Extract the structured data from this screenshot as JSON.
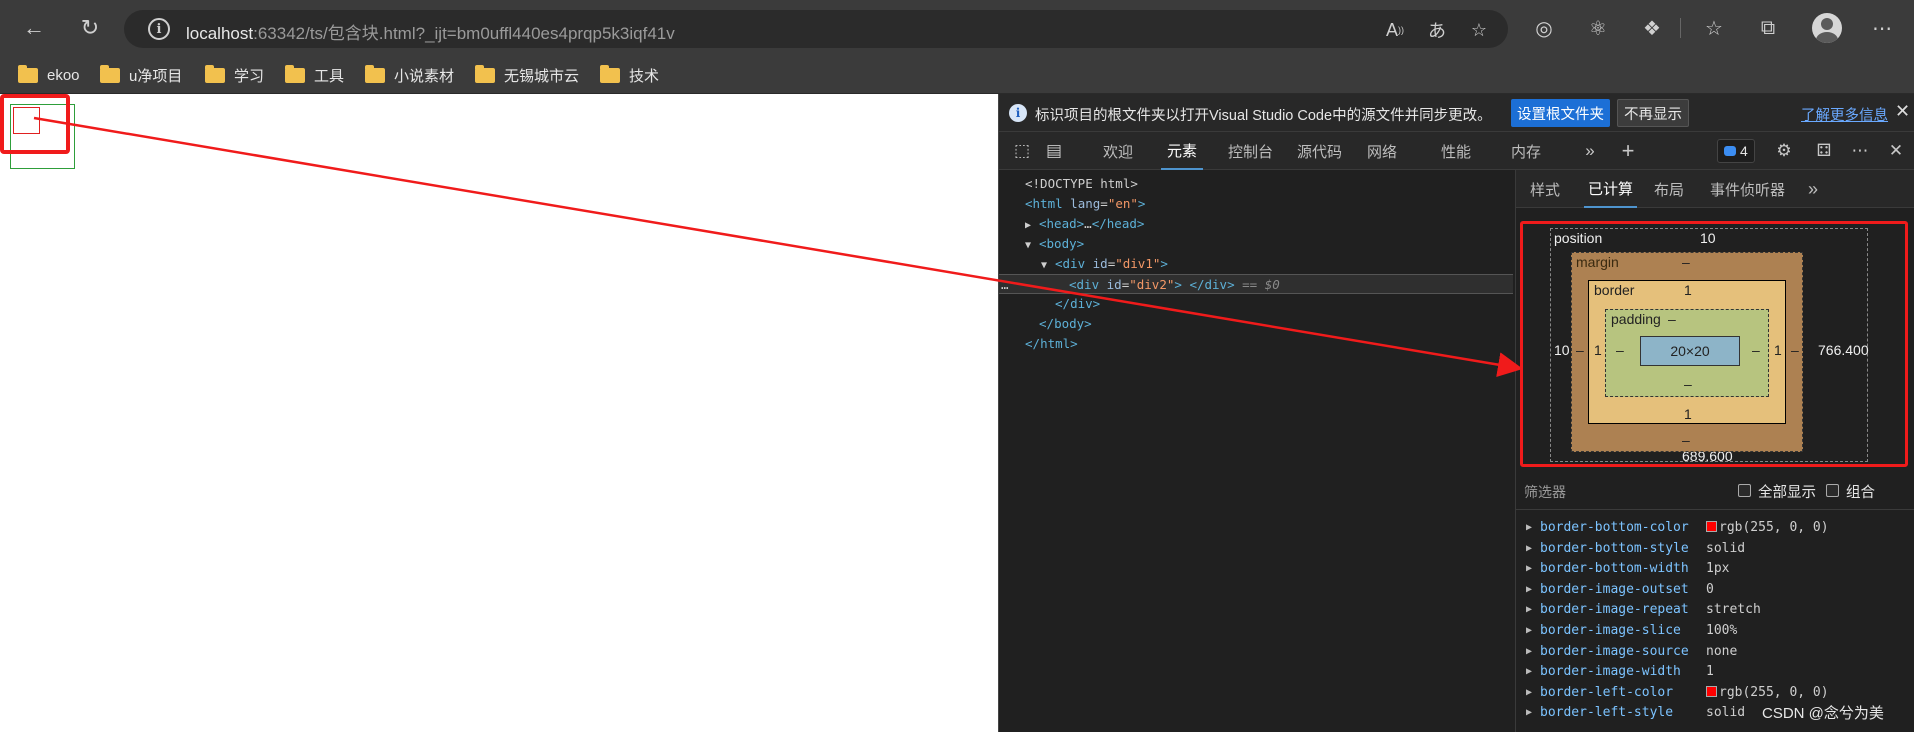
{
  "browser": {
    "url_host": "localhost",
    "url_rest": ":63342/ts/包含块.html?_ijt=bm0uffl440es4prqp5k3iqf41v",
    "bookmarks": [
      "ekoo",
      "u净项目",
      "学习",
      "工具",
      "小说素材",
      "无锡城市云",
      "技术"
    ]
  },
  "devtools": {
    "infobar": {
      "text": "标识项目的根文件夹以打开Visual Studio Code中的源文件并同步更改。",
      "set_root_button": "设置根文件夹",
      "dont_show_button": "不再显示",
      "learn_more_link": "了解更多信息"
    },
    "tabs": [
      "欢迎",
      "元素",
      "控制台",
      "源代码",
      "网络",
      "性能",
      "内存"
    ],
    "active_tab": "元素",
    "issues_count": "4",
    "elements_tree": {
      "doctype": "<!DOCTYPE html>",
      "html_tag": "html",
      "html_attr": "lang",
      "html_val": "\"en\"",
      "head_tag": "head",
      "body_tag": "body",
      "div_tag": "div",
      "div_attr": "id",
      "div1_val": "\"div1\"",
      "div2_val": "\"div2\"",
      "sel_marker": "== $0",
      "ellipsis": "…",
      "head_dots": "…"
    },
    "subtabs": [
      "样式",
      "已计算",
      "布局",
      "事件侦听器"
    ],
    "active_subtab": "已计算",
    "box_model": {
      "position_label": "position",
      "position_top": "10",
      "position_left": "10",
      "position_right": "766.400",
      "position_bottom": "689.600",
      "margin_label": "margin",
      "margin_top": "–",
      "margin_left": "–",
      "margin_right": "–",
      "margin_bottom": "–",
      "border_label": "border",
      "border_top": "1",
      "border_left": "1",
      "border_right": "1",
      "border_bottom": "1",
      "padding_label": "padding",
      "padding_top": "–",
      "padding_left": "–",
      "padding_right": "–",
      "padding_bottom": "–",
      "content": "20×20"
    },
    "filter": {
      "label": "筛选器",
      "show_all": "全部显示",
      "group": "组合"
    },
    "properties": [
      {
        "name": "border-bottom-color",
        "value": "rgb(255, 0, 0)",
        "swatch": "#ff0000"
      },
      {
        "name": "border-bottom-style",
        "value": "solid"
      },
      {
        "name": "border-bottom-width",
        "value": "1px"
      },
      {
        "name": "border-image-outset",
        "value": "0"
      },
      {
        "name": "border-image-repeat",
        "value": "stretch"
      },
      {
        "name": "border-image-slice",
        "value": "100%"
      },
      {
        "name": "border-image-source",
        "value": "none"
      },
      {
        "name": "border-image-width",
        "value": "1"
      },
      {
        "name": "border-left-color",
        "value": "rgb(255, 0, 0)",
        "swatch": "#ff0000"
      },
      {
        "name": "border-left-style",
        "value": "solid"
      }
    ]
  },
  "watermark": "CSDN @念兮为美",
  "colors": {
    "annotation_red": "#f01b1b",
    "accent_blue": "#1c6fd6"
  }
}
